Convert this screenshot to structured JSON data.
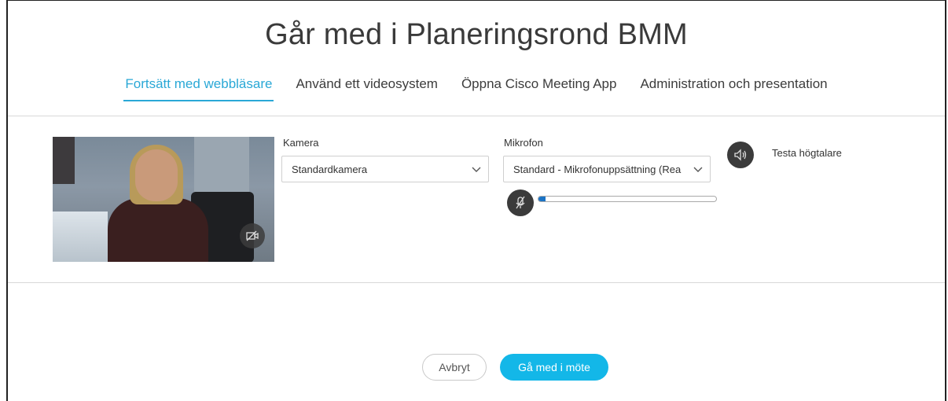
{
  "meeting": {
    "title": "Går med i Planeringsrond BMM"
  },
  "tabs": [
    {
      "label": "Fortsätt med webbläsare",
      "active": true
    },
    {
      "label": "Använd ett videosystem",
      "active": false
    },
    {
      "label": "Öppna Cisco Meeting App",
      "active": false
    },
    {
      "label": "Administration och presentation",
      "active": false
    }
  ],
  "camera": {
    "label": "Kamera",
    "selected": "Standardkamera",
    "toggle_icon": "camera-off-icon"
  },
  "microphone": {
    "label": "Mikrofon",
    "selected": "Standard - Mikrofonuppsättning (Rea",
    "mute_icon": "mic-muted-icon",
    "level_fraction": 0.04
  },
  "speaker": {
    "label": "Testa högtalare",
    "icon": "speaker-icon"
  },
  "actions": {
    "cancel_label": "Avbryt",
    "join_label": "Gå med i möte"
  },
  "colors": {
    "accent": "#2aa8d6",
    "join_button": "#13b7e8",
    "level": "#1b73c4"
  }
}
